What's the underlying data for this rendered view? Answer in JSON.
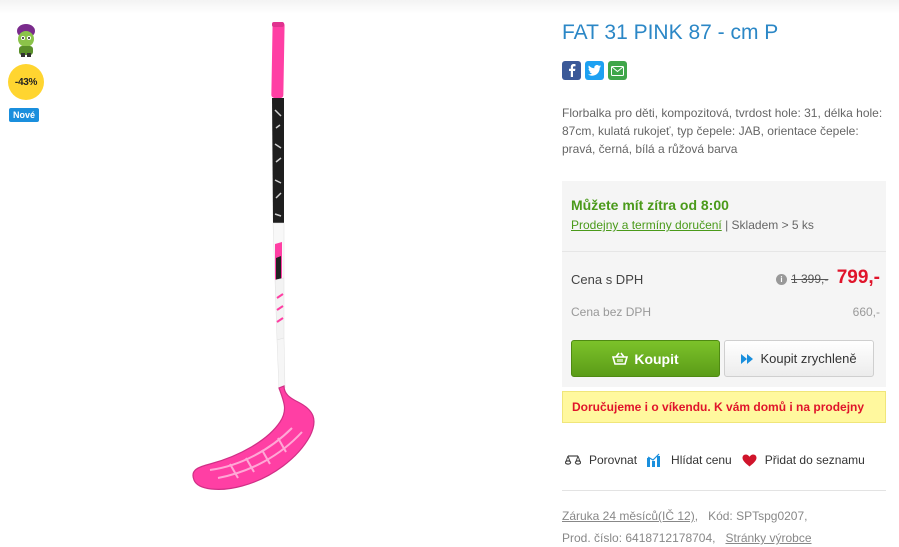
{
  "product": {
    "title": "FAT 31 PINK 87 - cm P",
    "description": "Florbalka pro děti, kompozitová, tvrdost hole: 31, délka hole: 87cm, kulatá rukojeť, typ čepele: JAB, orientace čepele: pravá, černá, bílá a růžová barva"
  },
  "badges": {
    "discount": "-43%",
    "new": "Nové"
  },
  "share": {
    "icons": [
      "facebook-icon",
      "twitter-icon",
      "email-icon"
    ]
  },
  "availability": {
    "title": "Můžete mít zítra od 8:00",
    "stores_link": "Prodejny a termíny doručení",
    "separator": " | ",
    "stock": "Skladem > 5 ks"
  },
  "price": {
    "with_vat_label": "Cena s DPH",
    "old": "1 399,-",
    "current": "799,-",
    "without_vat_label": "Cena bez DPH",
    "without_vat": "660,-"
  },
  "buttons": {
    "buy": "Koupit",
    "quick_buy": "Koupit zrychleně"
  },
  "notice": "Doručujeme i o víkendu. K vám domů i na prodejny",
  "actions": {
    "compare": "Porovnat",
    "watch_price": "Hlídat cenu",
    "wishlist": "Přidat do seznamu"
  },
  "meta": {
    "warranty": "Záruka 24 měsíců(IČ 12)",
    "code_label": "Kód:",
    "code": "SPTspg0207",
    "product_number_label": "Prod. číslo:",
    "product_number": "6418712178704",
    "manufacturer_link": "Stránky výrobce"
  },
  "colors": {
    "accent_blue": "#2b87c6",
    "green": "#4a9a1a",
    "price_red": "#e0142b",
    "stick_pink": "#ff3fa4"
  }
}
